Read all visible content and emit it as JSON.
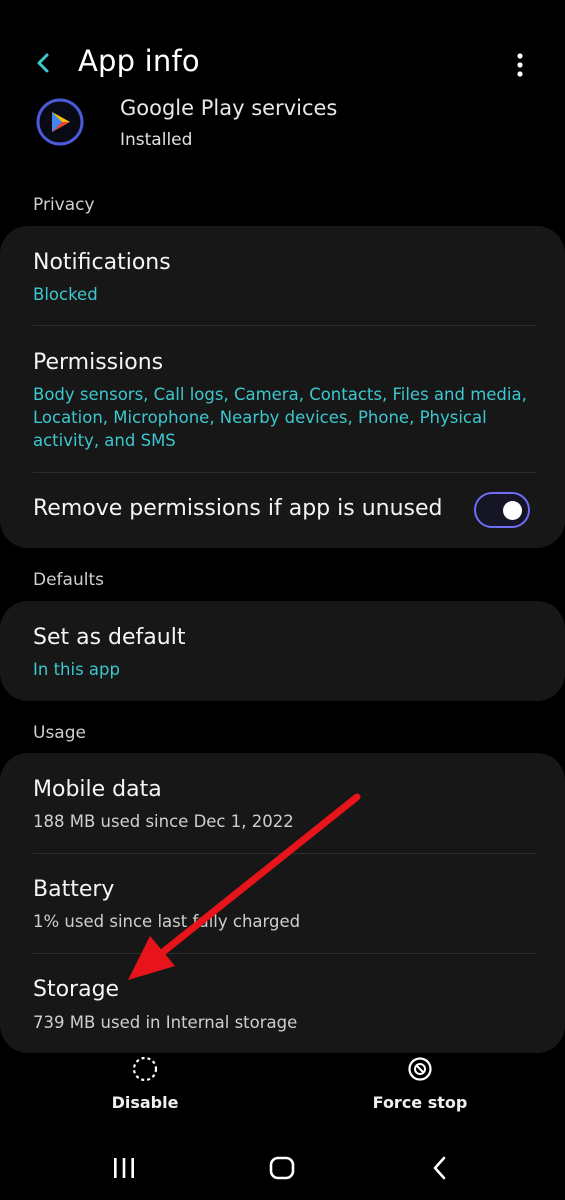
{
  "header": {
    "title": "App info"
  },
  "app": {
    "name": "Google Play services",
    "status": "Installed"
  },
  "sections": {
    "privacy": "Privacy",
    "defaults": "Defaults",
    "usage": "Usage"
  },
  "privacy": {
    "notifications": {
      "title": "Notifications",
      "value": "Blocked"
    },
    "permissions": {
      "title": "Permissions",
      "value": "Body sensors, Call logs, Camera, Contacts, Files and media, Location, Microphone, Nearby devices, Phone, Physical activity, and SMS"
    },
    "remove_unused": {
      "title": "Remove permissions if app is unused",
      "enabled": true
    }
  },
  "defaults": {
    "set_default": {
      "title": "Set as default",
      "value": "In this app"
    }
  },
  "usage": {
    "mobile_data": {
      "title": "Mobile data",
      "value": "188 MB used since Dec 1, 2022"
    },
    "battery": {
      "title": "Battery",
      "value": "1% used since last fully charged"
    },
    "storage": {
      "title": "Storage",
      "value": "739 MB used in Internal storage"
    }
  },
  "actions": {
    "disable": "Disable",
    "force_stop": "Force stop"
  },
  "colors": {
    "accent": "#3cc7cf",
    "toggle_border": "#6f6cf5",
    "annotation_arrow": "#e8141c"
  }
}
